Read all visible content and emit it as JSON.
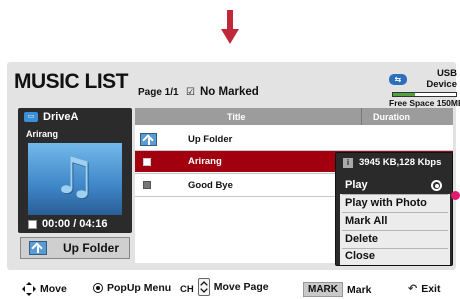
{
  "app": {
    "title": "MUSIC LIST"
  },
  "header": {
    "page": "Page 1/1",
    "marked": "No Marked"
  },
  "usb": {
    "device": "USB Device",
    "free_space": "Free Space 150MB",
    "used_fraction": 0.35
  },
  "drive": {
    "name": "DriveA",
    "track": "Arirang",
    "time": "00:00 / 04:16"
  },
  "left_button": {
    "label": "Up Folder"
  },
  "list": {
    "columns": {
      "title": "Title",
      "duration": "Duration"
    },
    "rows": [
      {
        "name": "Up Folder",
        "type": "folder"
      },
      {
        "name": "Arirang",
        "type": "file",
        "selected": true
      },
      {
        "name": "Good Bye",
        "type": "file"
      }
    ]
  },
  "popup": {
    "info": "3945 KB,128 Kbps",
    "items": [
      "Play",
      "Play with Photo",
      "Mark All",
      "Delete",
      "Close"
    ],
    "selected_index": 0
  },
  "footer": {
    "move": "Move",
    "popup_menu": "PopUp Menu",
    "ch": "CH",
    "move_page": "Move Page",
    "mark_key": "MARK",
    "mark": "Mark",
    "exit": "Exit"
  },
  "colors": {
    "accent_red": "#a3000f",
    "pointer_arrow": "#c0283a",
    "callout_dot": "#e0196c",
    "usb_blue": "#2d6fba",
    "free_space_green": "#4fa33a"
  },
  "icons": {
    "top": "down-arrow-icon",
    "usb": "usb-icon",
    "drive": "drive-icon",
    "folder": "up-folder-icon",
    "album": "music-note-icon",
    "stop": "stop-icon",
    "info": "info-icon",
    "radio": "radio-selected-icon",
    "move": "four-way-arrow-icon",
    "ok": "ok-button-icon",
    "ch": "ch-updown-icon",
    "exit": "back-exit-icon"
  }
}
